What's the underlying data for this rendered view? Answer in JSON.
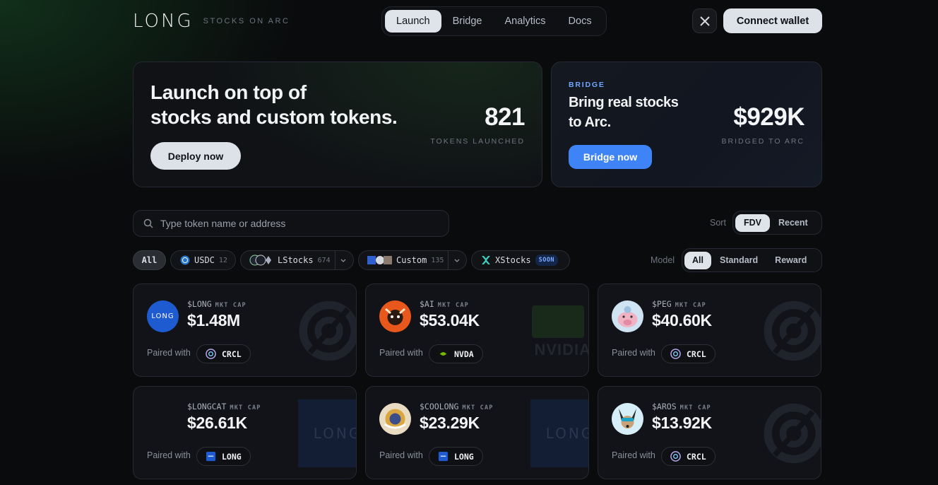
{
  "header": {
    "logo": "LONG",
    "tagline": "STOCKS ON ARC",
    "nav": [
      "Launch",
      "Bridge",
      "Analytics",
      "Docs"
    ],
    "x_icon": "x-logo-icon",
    "connect": "Connect wallet"
  },
  "launch": {
    "title_line1": "Launch on top of",
    "title_line2": "stocks and custom tokens.",
    "stat": "821",
    "stat_label": "TOKENS LAUNCHED",
    "cta": "Deploy now"
  },
  "bridge": {
    "kicker": "BRIDGE",
    "title_line1": "Bring real stocks",
    "title_line2": "to Arc.",
    "stat": "$929K",
    "stat_label": "BRIDGED TO ARC",
    "cta": "Bridge now"
  },
  "search": {
    "placeholder": "Type token name or address"
  },
  "sort": {
    "label": "Sort",
    "options": [
      "FDV",
      "Recent"
    ],
    "selected": "FDV"
  },
  "model": {
    "label": "Model",
    "options": [
      "All",
      "Standard",
      "Reward"
    ],
    "selected": "All"
  },
  "filters": [
    {
      "label": "All"
    },
    {
      "label": "USDC",
      "count": "12"
    },
    {
      "label": "LStocks",
      "count": "674"
    },
    {
      "label": "Custom",
      "count": "135"
    },
    {
      "label": "XStocks",
      "badge": "SOON"
    }
  ],
  "card_mc_label": "MKT CAP",
  "card_paired_label": "Paired with",
  "cards": [
    {
      "ticker": "$LONG",
      "mcap": "$1.48M",
      "pair": "CRCL",
      "avatar_text": "LONG"
    },
    {
      "ticker": "$AI",
      "mcap": "$53.04K",
      "pair": "NVDA",
      "watermark_text": "NVIDIA"
    },
    {
      "ticker": "$PEG",
      "mcap": "$40.60K",
      "pair": "CRCL"
    },
    {
      "ticker": "$LONGCAT",
      "mcap": "$26.61K",
      "pair": "LONG",
      "watermark_text": "LONG"
    },
    {
      "ticker": "$COOLONG",
      "mcap": "$23.29K",
      "pair": "LONG",
      "watermark_text": "LONG"
    },
    {
      "ticker": "$AROS",
      "mcap": "$13.92K",
      "pair": "CRCL"
    }
  ],
  "colors": {
    "accent_blue": "#3f84f7",
    "bg": "#0a0b0d",
    "card": "#111318"
  }
}
